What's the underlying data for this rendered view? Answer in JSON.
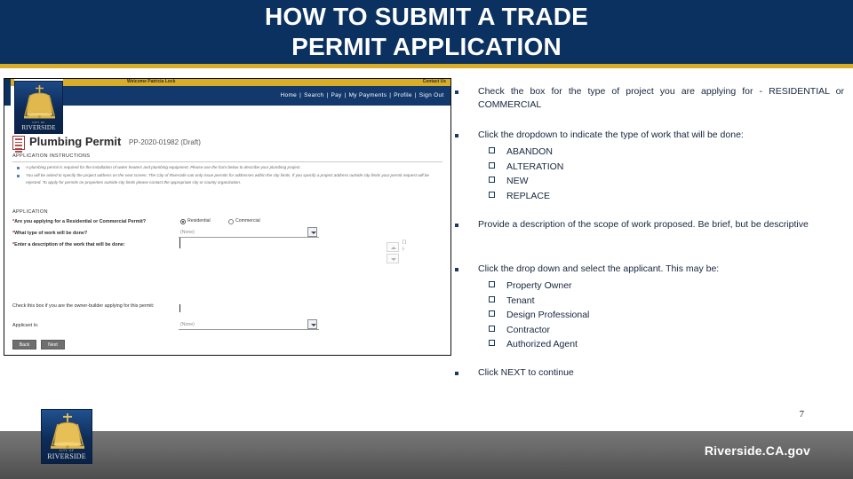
{
  "slide": {
    "title_line1": "HOW TO SUBMIT A TRADE",
    "title_line2": "PERMIT APPLICATION",
    "page_number": "7",
    "footer_url": "Riverside.CA.gov",
    "colors": {
      "header_navy": "#0b3160",
      "gold_rule": "#d8ae28",
      "bullet_navy": "#1b3a5e",
      "footer_gray": "#6a6a6a"
    }
  },
  "screenshot": {
    "welcome": "Welcome Patricia Lock",
    "contact_us": "Contact Us",
    "nav_links": [
      "Home",
      "Search",
      "Pay",
      "My Payments",
      "Profile",
      "Sign Out"
    ],
    "nav_separator": "|",
    "logo": {
      "city_of": "CITY OF",
      "name": "RIVERSIDE"
    },
    "permit_title": "Plumbing Permit",
    "permit_subtitle": "PP-2020-01982 (Draft)",
    "instructions_heading": "APPLICATION INSTRUCTIONS",
    "instructions": [
      "A plumbing permit is required for the installation of water heaters and plumbing equipment. Please use the form below to describe your plumbing project.",
      "You will be asked to specify the project address on the next screen. The City of Riverside can only issue permits for addresses within the city limits. If you specify a project address outside city limits your permit request will be rejected. To apply for permits on properties outside city limits please contact the appropriate city or county organization."
    ],
    "application_heading": "APPLICATION",
    "fields": {
      "permit_type_label": "Are you applying for a Residential or Commercial Permit?",
      "permit_type_options": [
        "Residential",
        "Commercial"
      ],
      "permit_type_selected": "Residential",
      "work_type_label": "What type of work will be done?",
      "work_type_value": "(None)",
      "description_label": "Enter a description of the work that will be done:",
      "description_value": "",
      "owner_builder_label": "Check this box if you are the owner-builder applying for this permit:",
      "applicant_label": "Applicant Is:",
      "applicant_value": "(None)"
    },
    "buttons": {
      "back": "Back",
      "next": "Next"
    },
    "spinner_chars": [
      "[ ]",
      "|-"
    ]
  },
  "bullets": [
    {
      "text": "Check the box for the type of project you are applying for - RESIDENTIAL or COMMERCIAL",
      "justify": true,
      "sub_items": []
    },
    {
      "text": "Click the dropdown to indicate the type of work that will be done:",
      "justify": false,
      "sub_items": [
        "ABANDON",
        "ALTERATION",
        "NEW",
        "REPLACE"
      ]
    },
    {
      "text": "Provide a description of the scope of work proposed.  Be brief, but be descriptive",
      "justify": false,
      "sub_items": []
    },
    {
      "text": "Click the drop down and select the applicant.  This may be:",
      "justify": false,
      "sub_items": [
        "Property Owner",
        "Tenant",
        "Design Professional",
        "Contractor",
        "Authorized Agent"
      ]
    },
    {
      "text": "Click NEXT to continue",
      "justify": false,
      "sub_items": []
    }
  ]
}
